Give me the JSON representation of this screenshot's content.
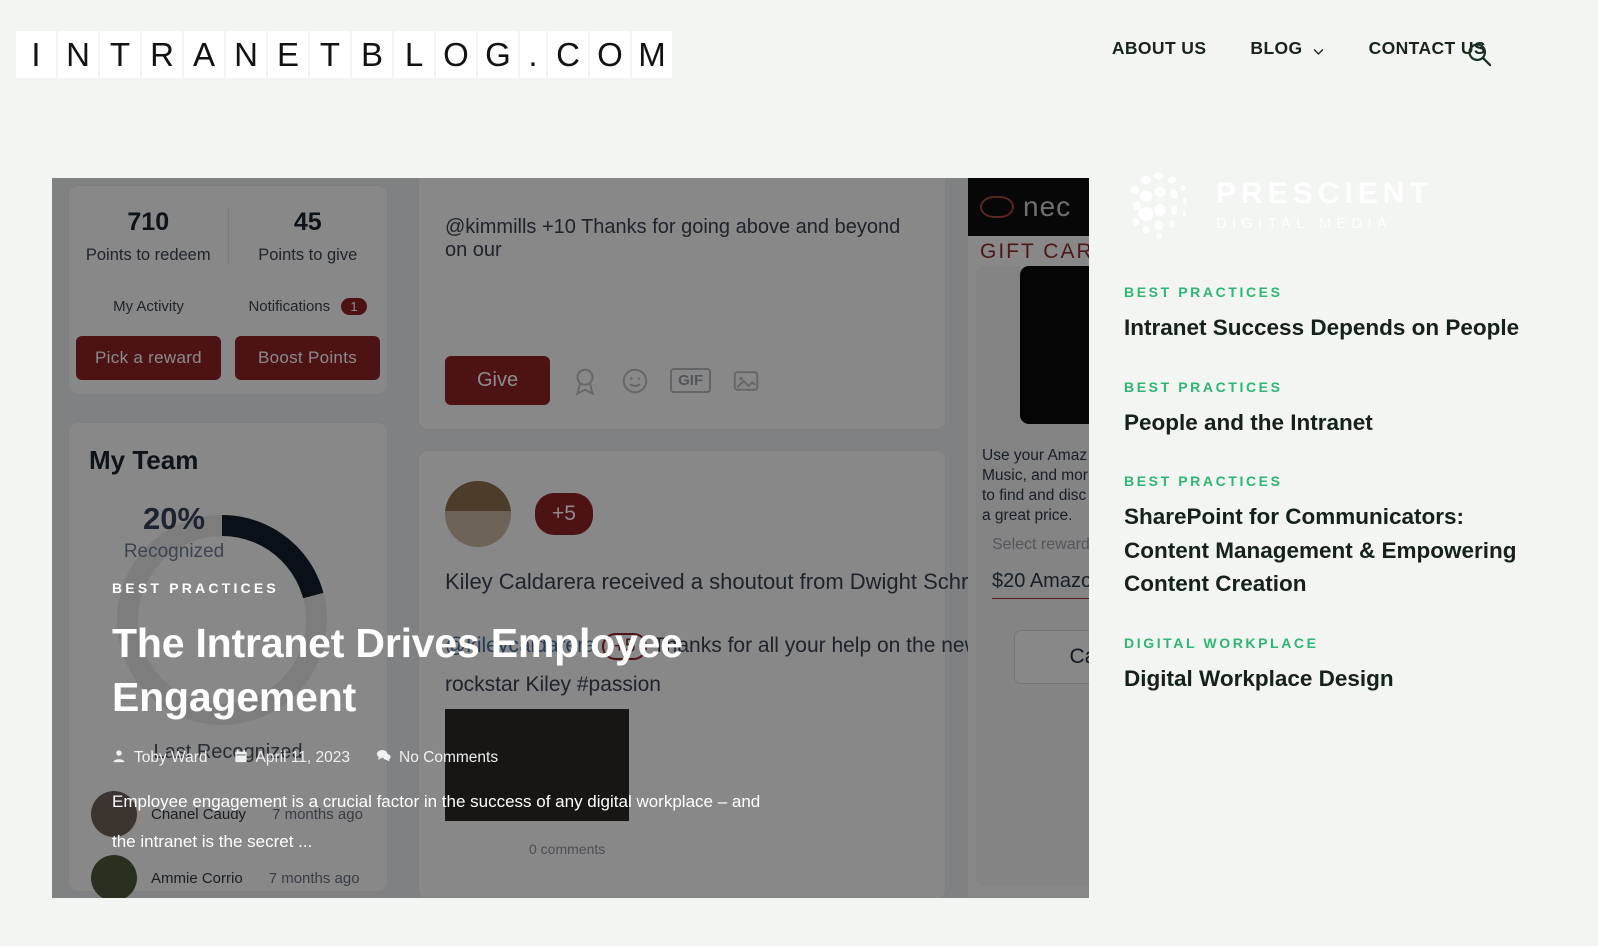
{
  "header": {
    "logo_text": "INTRANETBLOG.COM",
    "nav": [
      {
        "label": "ABOUT US",
        "has_dropdown": false
      },
      {
        "label": "BLOG",
        "has_dropdown": true
      },
      {
        "label": "CONTACT US",
        "has_dropdown": false
      }
    ],
    "search_icon": "search-icon"
  },
  "hero": {
    "category": "BEST PRACTICES",
    "title": "The Intranet Drives Employee Engagement",
    "author": "Toby Ward",
    "date": "April 11, 2023",
    "comments": "No Comments",
    "excerpt": "Employee engagement is a crucial factor in the success of any digital workplace – and the intranet is the secret ...",
    "background_app": {
      "rewards": {
        "points_to_redeem_value": "710",
        "points_to_redeem_label": "Points to redeem",
        "points_to_give_value": "45",
        "points_to_give_label": "Points to give",
        "my_activity_label": "My Activity",
        "notifications_label": "Notifications",
        "notifications_count": "1",
        "pick_reward_button": "Pick a reward",
        "boost_points_button": "Boost Points"
      },
      "team": {
        "title": "My Team",
        "percent": "20%",
        "percent_label": "Recognized",
        "last_recognized_label": "Last Recognized",
        "members": [
          {
            "name": "Chanel Caudy",
            "time": "7 months ago"
          },
          {
            "name": "Ammie Corrio",
            "time": "7 months ago"
          }
        ]
      },
      "compose": {
        "text": "@kimmills +10 Thanks for going above and beyond on our",
        "give_button": "Give",
        "gif_label": "GIF"
      },
      "feed": {
        "points_badge": "+5",
        "headline": "Kiley Caldarera received a shoutout from Dwight Schrute",
        "mention": "@kileycaldarera",
        "mention_points": "+5",
        "message": "Thanks for all your help on the new w",
        "message_line2": "rockstar Kiley #passion",
        "comments": "0 comments"
      },
      "nectar": {
        "brand": "nec",
        "gift_card_label": "GIFT CARD",
        "description": "Use your Amaz\nMusic, and mor\nto find and disc\na great price.",
        "select_reward_label": "Select reward",
        "reward_value": "$20 Amazo",
        "cancel_button": "Canc"
      }
    }
  },
  "sidebar": {
    "brand": {
      "name": "PRESCIENT",
      "subtitle": "DIGITAL MEDIA"
    },
    "posts": [
      {
        "category": "BEST PRACTICES",
        "title": "Intranet Success Depends on People"
      },
      {
        "category": "BEST PRACTICES",
        "title": "People and the Intranet"
      },
      {
        "category": "BEST PRACTICES",
        "title": "SharePoint for Communicators: Content Management & Empowering Content Creation"
      },
      {
        "category": "DIGITAL WORKPLACE",
        "title": "Digital Workplace Design"
      }
    ]
  },
  "colors": {
    "page_bg": "#f2f5f1",
    "accent_green": "#2eb673",
    "text_dark": "#15211b",
    "mock_red": "#8e2225"
  }
}
